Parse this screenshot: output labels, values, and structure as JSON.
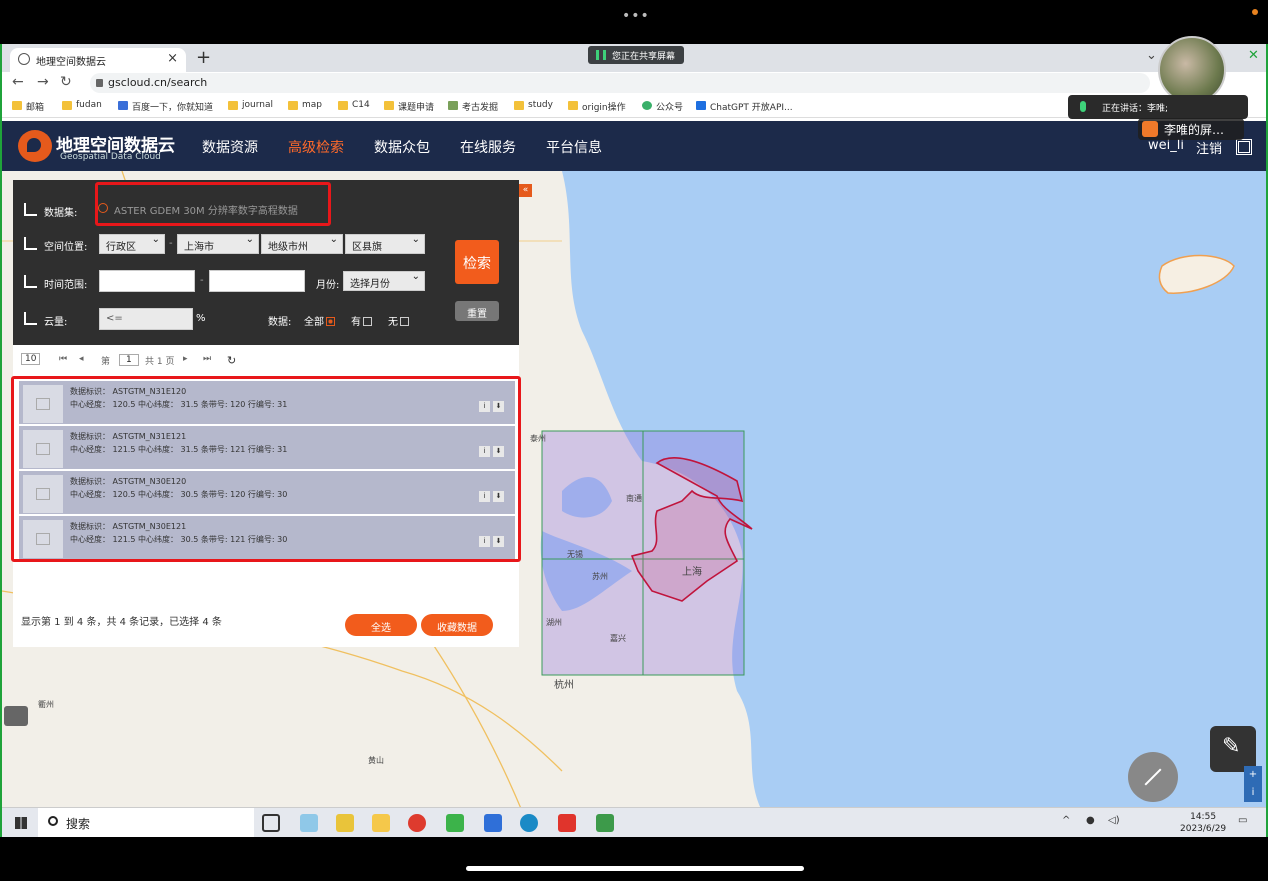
{
  "browser": {
    "tab_title": "地理空间数据云",
    "tab_close": "×",
    "new_tab": "+",
    "url": "gscloud.cn/search",
    "share_badge": "您正在共享屏幕",
    "bookmarks": [
      "邮箱",
      "fudan",
      "百度一下，你就知道",
      "journal",
      "map",
      "C14",
      "课题申请",
      "考古发掘",
      "study",
      "origin操作",
      "公众号",
      "ChatGPT 开放API..."
    ]
  },
  "meeting": {
    "speaking": "正在讲话：李唯;",
    "viewer": "李唯的屏…"
  },
  "site": {
    "logo_cn": "地理空间数据云",
    "logo_en": "Geospatial Data Cloud",
    "nav": [
      "数据资源",
      "高级检索",
      "数据众包",
      "在线服务",
      "平台信息"
    ],
    "active_nav": "高级检索",
    "user": "wei_li",
    "logout": "注销"
  },
  "search_panel": {
    "dataset_label": "数据集:",
    "dataset_value": "ASTER GDEM 30M 分辨率数字高程数据",
    "location_label": "空间位置:",
    "location_type": "行政区",
    "province": "上海市",
    "city": "地级市州",
    "county": "区县旗",
    "time_label": "时间范围:",
    "month_label": "月份:",
    "month_value": "选择月份",
    "cloud_label": "云量:",
    "cloud_placeholder": "<=",
    "cloud_unit": "%",
    "data_label": "数据:",
    "opt_all": "全部",
    "opt_yes": "有",
    "opt_no": "无",
    "search_button": "检索",
    "reset_button": "重置",
    "collapse": "«",
    "dash": "-"
  },
  "pager": {
    "page_size": "10",
    "page_prefix": "第",
    "page_value": "1",
    "page_total": "共 1 页"
  },
  "results": [
    {
      "id_line": "数据标识：  ASTGTM_N31E120",
      "info_line": "中心经度：  120.5  中心纬度：  31.5  条带号: 120  行编号: 31"
    },
    {
      "id_line": "数据标识：  ASTGTM_N31E121",
      "info_line": "中心经度：  121.5  中心纬度：  31.5  条带号: 121  行编号: 31"
    },
    {
      "id_line": "数据标识：  ASTGTM_N30E120",
      "info_line": "中心经度：  120.5  中心纬度：  30.5  条带号: 120  行编号: 30"
    },
    {
      "id_line": "数据标识：  ASTGTM_N30E121",
      "info_line": "中心经度：  121.5  中心纬度：  30.5  条带号: 121  行编号: 30"
    }
  ],
  "results_footer": {
    "summary": "显示第 1 到 4 条，共 4 条记录，已选择 4 条",
    "select_all": "全选",
    "collect": "收藏数据"
  },
  "map_labels": [
    "上海",
    "无锡",
    "苏州",
    "杭州",
    "湖州",
    "嘉兴",
    "南通",
    "泰州",
    "黄山",
    "衢州"
  ],
  "taskbar": {
    "search": "搜索",
    "time": "14:55",
    "date": "2023/6/29"
  },
  "colors": {
    "header_bg": "#1c2a4a",
    "accent": "#f25c1c",
    "highlight_box": "#e8171a",
    "result_row": "#b5b8cc"
  }
}
